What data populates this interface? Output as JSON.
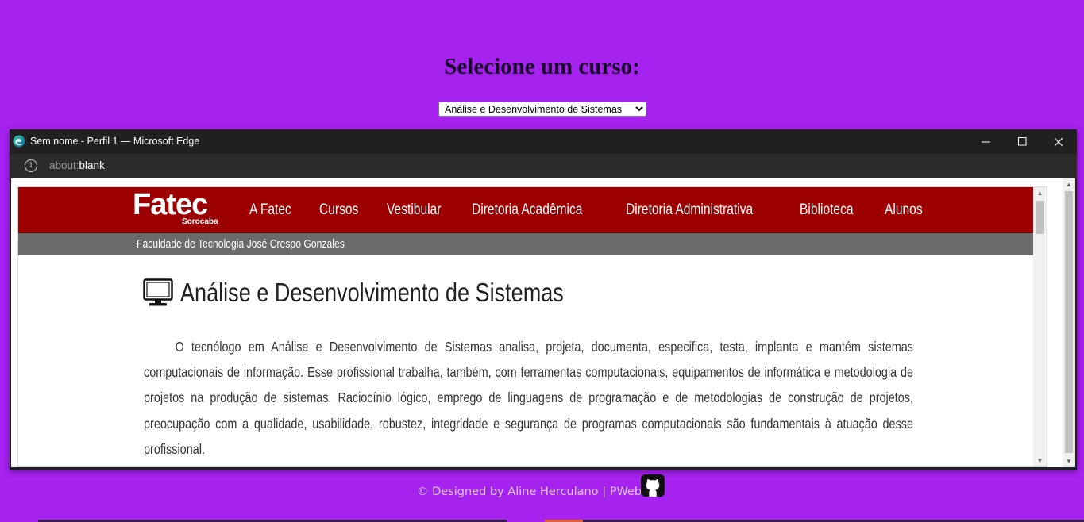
{
  "page": {
    "title": "Selecione um curso:",
    "select": {
      "selected": "Análise e Desenvolvimento de Sistemas"
    }
  },
  "browser": {
    "window_title": "Sem nome - Perfil 1 — Microsoft Edge",
    "address_prefix": "about:",
    "address_strong": "blank",
    "buttons": {
      "minimize": "—",
      "maximize": "☐",
      "close": "✕"
    }
  },
  "site": {
    "logo": "Fatec",
    "logo_sub": "Sorocaba",
    "nav": [
      "A Fatec",
      "Cursos",
      "Vestibular",
      "Diretoria Acadêmica",
      "Diretoria Administrativa",
      "Biblioteca",
      "Alunos"
    ],
    "subtitle": "Faculdade de Tecnologia José Crespo Gonzales",
    "course": {
      "title": "Análise e Desenvolvimento de Sistemas",
      "description": "O tecnólogo em Análise e Desenvolvimento de Sistemas analisa, projeta, documenta, especifica, testa, implanta e mantém sistemas computacionais de informação. Esse profissional trabalha, também, com ferramentas computacionais, equipamentos de informática e metodologia de projetos na produção de sistemas. Raciocínio lógico, emprego de linguagens de programação e de metodologias de construção de projetos, preocupação com a qualidade, usabilidade, robustez, integridade e segurança de programas computacionais são fundamentais à atuação desse profissional."
    }
  },
  "footer": {
    "text": "© Designed by Aline Herculano | PWeb"
  },
  "colors": {
    "background": "#a622ef",
    "fatec_red": "#9c0000",
    "subbar_gray": "#6b6b6b"
  },
  "icons": {
    "browser": "edge-logo-icon",
    "info": "info-icon",
    "course": "monitor-icon",
    "footer": "github-icon"
  }
}
